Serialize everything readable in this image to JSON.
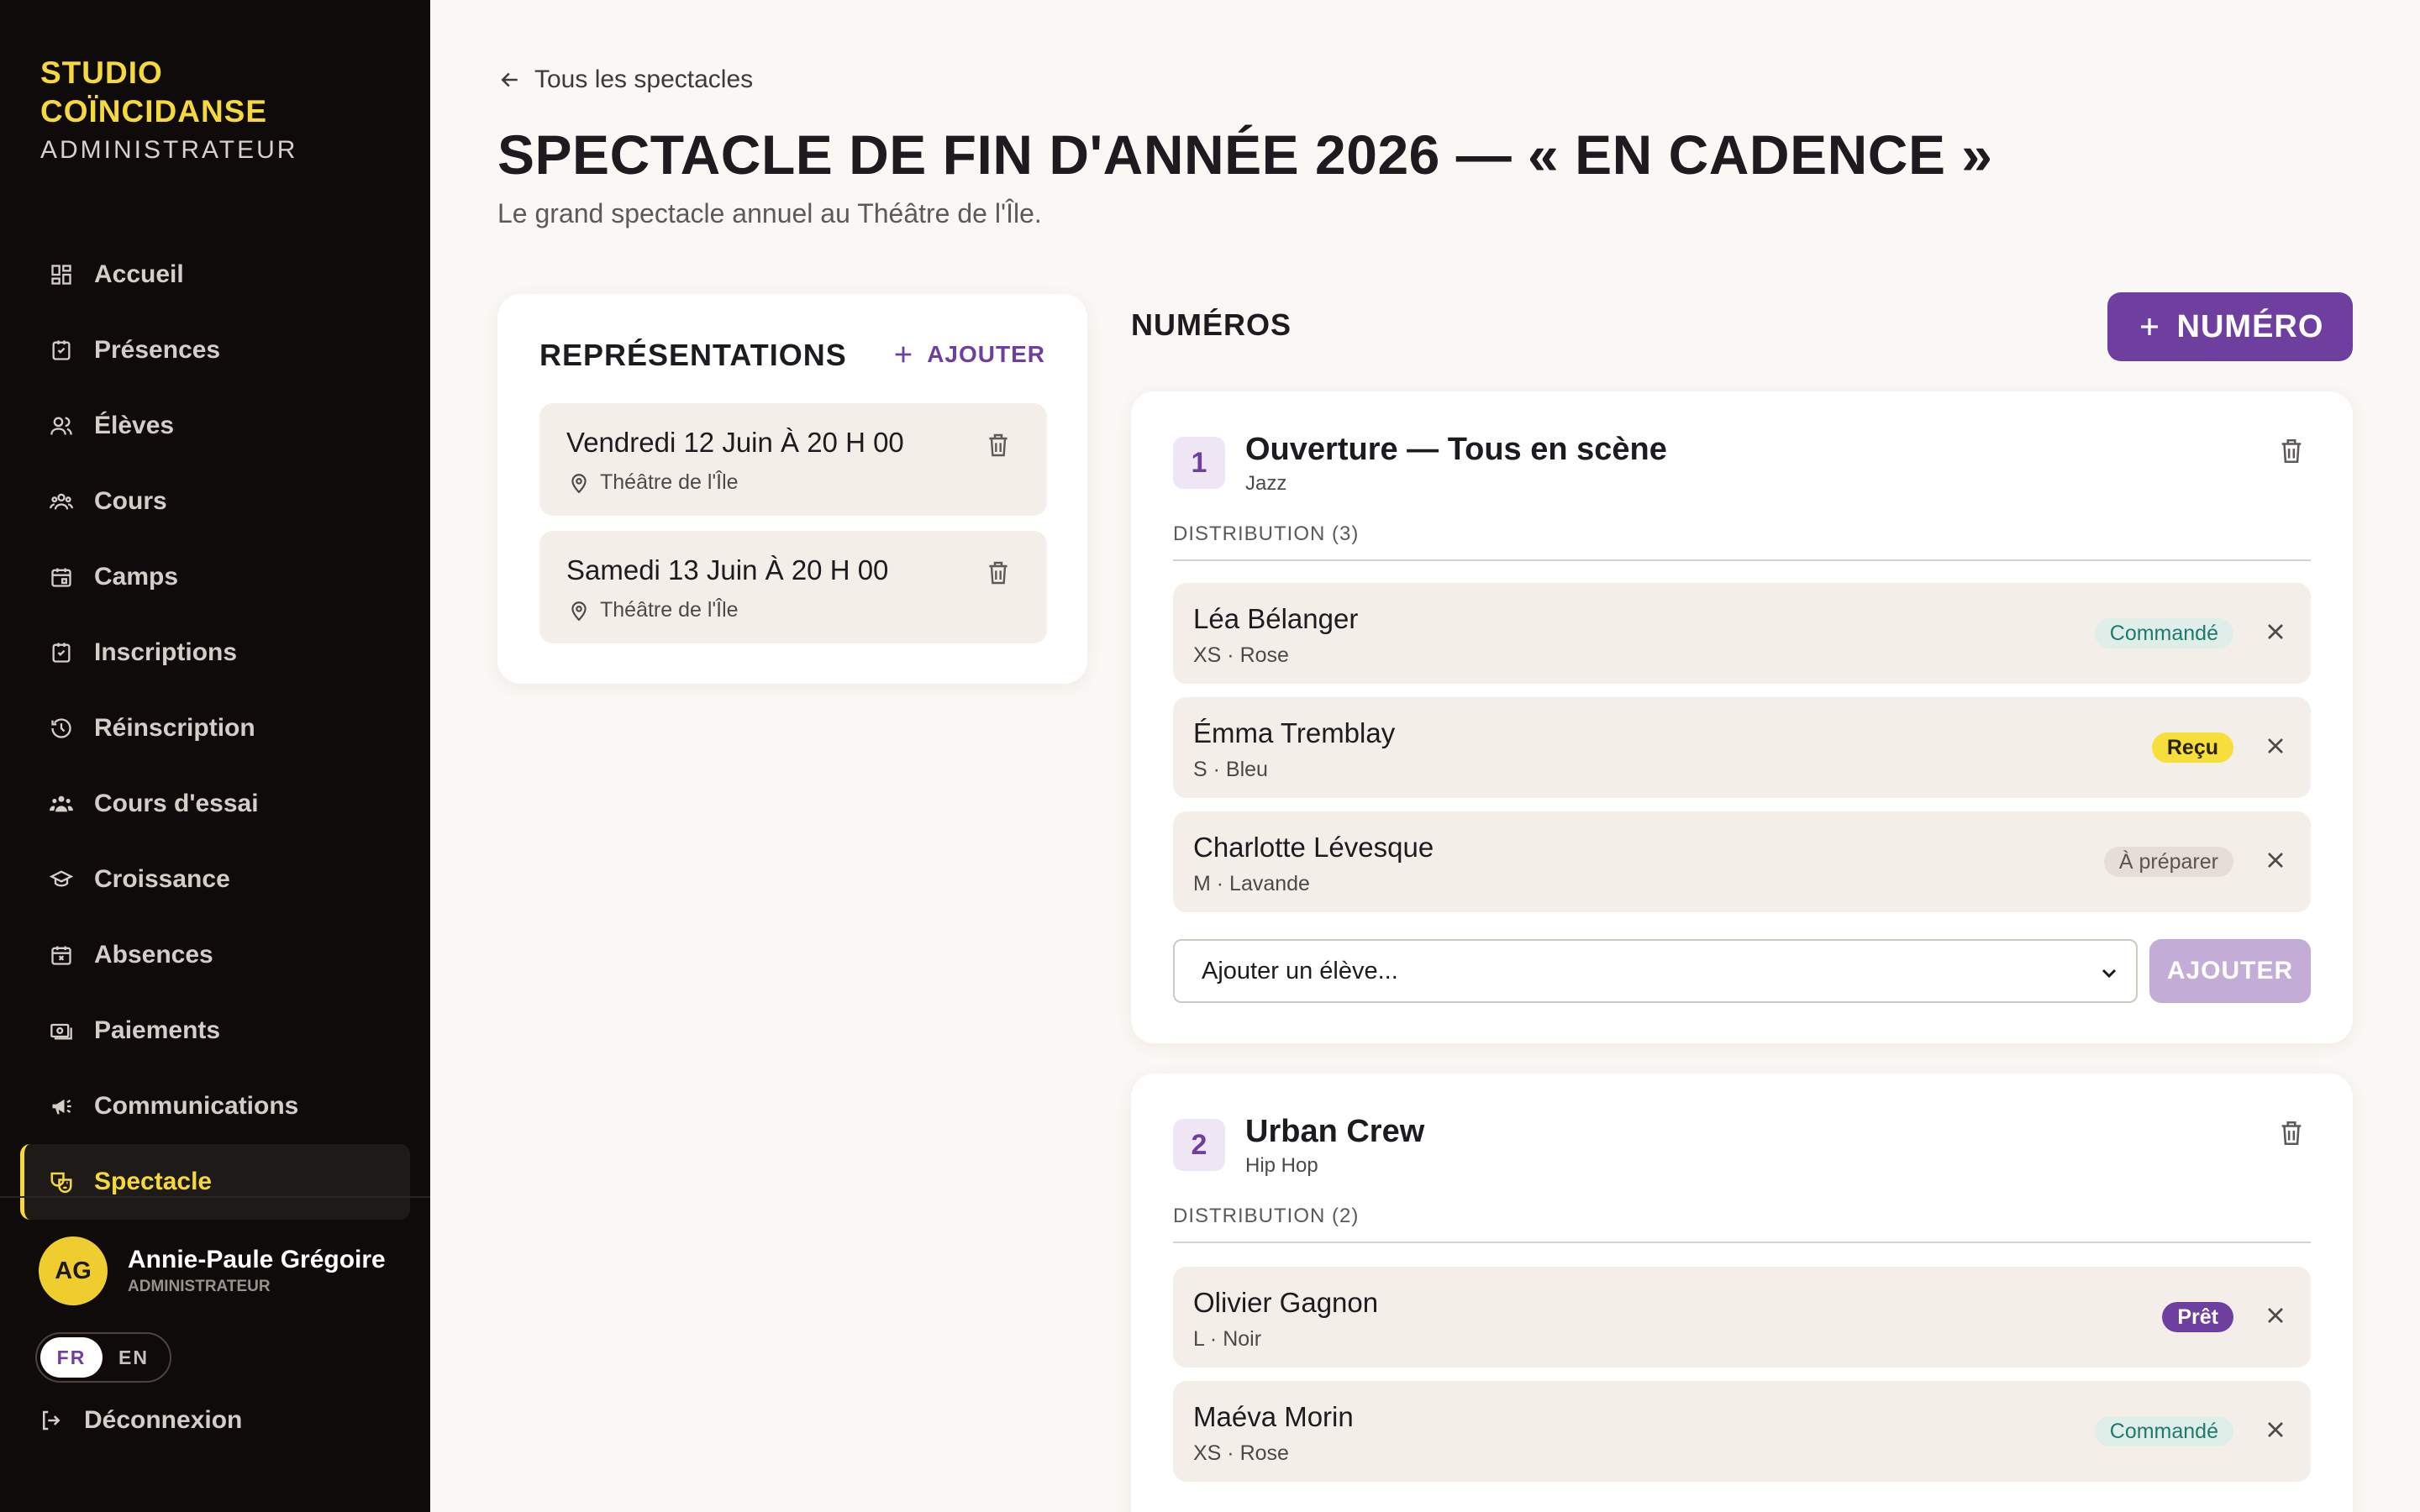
{
  "brand": {
    "line1": "STUDIO",
    "line2": "COÏNCIDANSE",
    "role": "ADMINISTRATEUR"
  },
  "nav": [
    {
      "label": "Accueil",
      "icon": "dashboard-icon"
    },
    {
      "label": "Présences",
      "icon": "checklist-icon"
    },
    {
      "label": "Élèves",
      "icon": "users-icon"
    },
    {
      "label": "Cours",
      "icon": "group-icon"
    },
    {
      "label": "Camps",
      "icon": "calendar-icon"
    },
    {
      "label": "Inscriptions",
      "icon": "checklist-icon"
    },
    {
      "label": "Réinscription",
      "icon": "history-icon"
    },
    {
      "label": "Cours d'essai",
      "icon": "group-icon"
    },
    {
      "label": "Croissance",
      "icon": "graduation-cap-icon"
    },
    {
      "label": "Absences",
      "icon": "calendar-x-icon"
    },
    {
      "label": "Paiements",
      "icon": "money-icon"
    },
    {
      "label": "Communications",
      "icon": "megaphone-icon"
    },
    {
      "label": "Spectacle",
      "icon": "theater-masks-icon",
      "active": true
    }
  ],
  "user": {
    "initials": "AG",
    "name": "Annie-Paule Grégoire",
    "role": "ADMINISTRATEUR"
  },
  "lang": {
    "fr": "FR",
    "en": "EN",
    "active": "FR"
  },
  "logout": "Déconnexion",
  "header": {
    "back": "Tous les spectacles",
    "title": "SPECTACLE DE FIN D'ANNÉE 2026 — « EN CADENCE »",
    "subtitle": "Le grand spectacle annuel au Théâtre de l'Île."
  },
  "representations": {
    "title": "REPRÉSENTATIONS",
    "add_label": "AJOUTER",
    "items": [
      {
        "date": "Vendredi 12 Juin À 20 H 00",
        "place": "Théâtre de l'Île"
      },
      {
        "date": "Samedi 13 Juin À 20 H 00",
        "place": "Théâtre de l'Île"
      }
    ]
  },
  "numeros": {
    "title": "NUMÉROS",
    "add_label": "NUMÉRO",
    "items": [
      {
        "number": "1",
        "name": "Ouverture — Tous en scène",
        "style": "Jazz",
        "distribution_label": "DISTRIBUTION (3)",
        "dancers": [
          {
            "name": "Léa Bélanger",
            "detail": "XS · Rose",
            "status": "Commandé"
          },
          {
            "name": "Émma Tremblay",
            "detail": "S · Bleu",
            "status": "Reçu"
          },
          {
            "name": "Charlotte Lévesque",
            "detail": "M · Lavande",
            "status": "À préparer"
          }
        ],
        "add_placeholder": "Ajouter un élève...",
        "add_button": "AJOUTER"
      },
      {
        "number": "2",
        "name": "Urban Crew",
        "style": "Hip Hop",
        "distribution_label": "DISTRIBUTION (2)",
        "dancers": [
          {
            "name": "Olivier Gagnon",
            "detail": "L · Noir",
            "status": "Prêt"
          },
          {
            "name": "Maéva Morin",
            "detail": "XS · Rose",
            "status": "Commandé"
          }
        ]
      }
    ]
  },
  "colors": {
    "accent": "#6f3fa0",
    "brand_yellow": "#f5d83a",
    "sidebar_bg": "#0f0b0b",
    "page_bg": "#faf8f4"
  }
}
